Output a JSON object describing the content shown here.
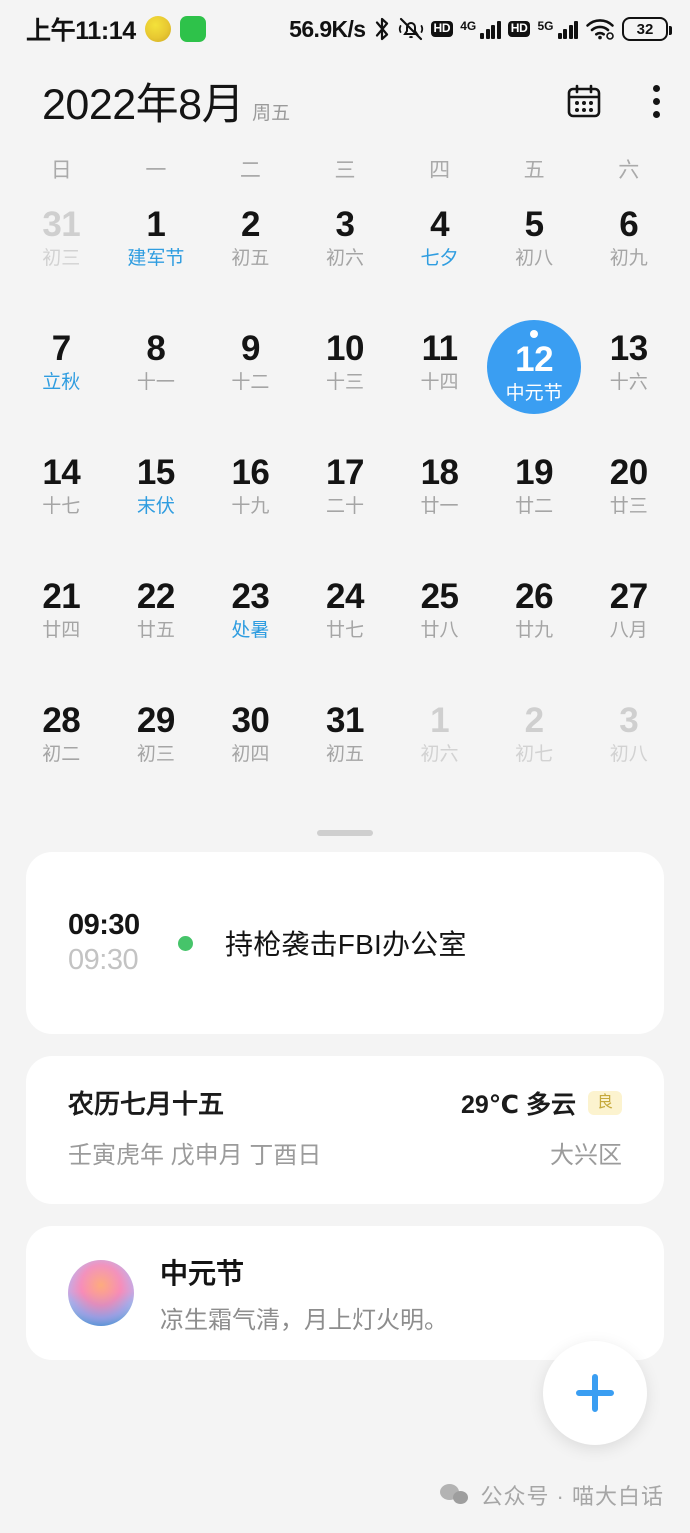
{
  "statusbar": {
    "time": "上午11:14",
    "network_speed": "56.9K/s",
    "hd_label_1": "HD",
    "gen_label_1": "4G",
    "hd_label_2": "HD",
    "gen_label_2": "5G",
    "battery": "32",
    "icons": [
      "notification-badge-yellow",
      "notification-badge-green",
      "bluetooth-icon",
      "mute-vibrate-icon",
      "signal-bars-icon",
      "wifi-icon",
      "battery-icon"
    ]
  },
  "header": {
    "title": "2022年8月",
    "weekday": "周五",
    "calendar_icon": "calendar-icon",
    "menu_icon": "more-vertical-icon"
  },
  "calendar": {
    "weekday_headers": [
      "日",
      "一",
      "二",
      "三",
      "四",
      "五",
      "六"
    ],
    "weeks": [
      [
        {
          "day": "31",
          "lunar": "初三",
          "dim": true,
          "selected": false,
          "highlight": false
        },
        {
          "day": "1",
          "lunar": "建军节",
          "dim": false,
          "selected": false,
          "highlight": true
        },
        {
          "day": "2",
          "lunar": "初五",
          "dim": false,
          "selected": false,
          "highlight": false
        },
        {
          "day": "3",
          "lunar": "初六",
          "dim": false,
          "selected": false,
          "highlight": false
        },
        {
          "day": "4",
          "lunar": "七夕",
          "dim": false,
          "selected": false,
          "highlight": true
        },
        {
          "day": "5",
          "lunar": "初八",
          "dim": false,
          "selected": false,
          "highlight": false
        },
        {
          "day": "6",
          "lunar": "初九",
          "dim": false,
          "selected": false,
          "highlight": false
        }
      ],
      [
        {
          "day": "7",
          "lunar": "立秋",
          "dim": false,
          "selected": false,
          "highlight": true
        },
        {
          "day": "8",
          "lunar": "十一",
          "dim": false,
          "selected": false,
          "highlight": false
        },
        {
          "day": "9",
          "lunar": "十二",
          "dim": false,
          "selected": false,
          "highlight": false
        },
        {
          "day": "10",
          "lunar": "十三",
          "dim": false,
          "selected": false,
          "highlight": false
        },
        {
          "day": "11",
          "lunar": "十四",
          "dim": false,
          "selected": false,
          "highlight": false
        },
        {
          "day": "12",
          "lunar": "中元节",
          "dim": false,
          "selected": true,
          "highlight": false
        },
        {
          "day": "13",
          "lunar": "十六",
          "dim": false,
          "selected": false,
          "highlight": false
        }
      ],
      [
        {
          "day": "14",
          "lunar": "十七",
          "dim": false,
          "selected": false,
          "highlight": false
        },
        {
          "day": "15",
          "lunar": "末伏",
          "dim": false,
          "selected": false,
          "highlight": true
        },
        {
          "day": "16",
          "lunar": "十九",
          "dim": false,
          "selected": false,
          "highlight": false
        },
        {
          "day": "17",
          "lunar": "二十",
          "dim": false,
          "selected": false,
          "highlight": false
        },
        {
          "day": "18",
          "lunar": "廿一",
          "dim": false,
          "selected": false,
          "highlight": false
        },
        {
          "day": "19",
          "lunar": "廿二",
          "dim": false,
          "selected": false,
          "highlight": false
        },
        {
          "day": "20",
          "lunar": "廿三",
          "dim": false,
          "selected": false,
          "highlight": false
        }
      ],
      [
        {
          "day": "21",
          "lunar": "廿四",
          "dim": false,
          "selected": false,
          "highlight": false
        },
        {
          "day": "22",
          "lunar": "廿五",
          "dim": false,
          "selected": false,
          "highlight": false
        },
        {
          "day": "23",
          "lunar": "处暑",
          "dim": false,
          "selected": false,
          "highlight": true
        },
        {
          "day": "24",
          "lunar": "廿七",
          "dim": false,
          "selected": false,
          "highlight": false
        },
        {
          "day": "25",
          "lunar": "廿八",
          "dim": false,
          "selected": false,
          "highlight": false
        },
        {
          "day": "26",
          "lunar": "廿九",
          "dim": false,
          "selected": false,
          "highlight": false
        },
        {
          "day": "27",
          "lunar": "八月",
          "dim": false,
          "selected": false,
          "highlight": false
        }
      ],
      [
        {
          "day": "28",
          "lunar": "初二",
          "dim": false,
          "selected": false,
          "highlight": false
        },
        {
          "day": "29",
          "lunar": "初三",
          "dim": false,
          "selected": false,
          "highlight": false
        },
        {
          "day": "30",
          "lunar": "初四",
          "dim": false,
          "selected": false,
          "highlight": false
        },
        {
          "day": "31",
          "lunar": "初五",
          "dim": false,
          "selected": false,
          "highlight": false
        },
        {
          "day": "1",
          "lunar": "初六",
          "dim": true,
          "selected": false,
          "highlight": false
        },
        {
          "day": "2",
          "lunar": "初七",
          "dim": true,
          "selected": false,
          "highlight": false
        },
        {
          "day": "3",
          "lunar": "初八",
          "dim": true,
          "selected": false,
          "highlight": false
        }
      ]
    ]
  },
  "event": {
    "start_time": "09:30",
    "end_time": "09:30",
    "title": "持枪袭击FBI办公室",
    "dot_color": "#46c46a"
  },
  "info": {
    "lunar_date": "农历七月十五",
    "ganzhi": "壬寅虎年 戊申月 丁酉日",
    "weather": "29℃ 多云",
    "aqi": "良",
    "location": "大兴区"
  },
  "festival": {
    "name": "中元节",
    "description": "凉生霜气清，月上灯火明。",
    "thumbnail": "lotus-lantern-image"
  },
  "fab": {
    "label": "+",
    "icon": "plus-icon",
    "color": "#3a9ef2"
  },
  "watermark": {
    "text": "公众号 · 喵大白话",
    "icon": "wechat-icon"
  },
  "colors": {
    "accent": "#3a9ef2",
    "highlight_text": "#2f9de0",
    "background": "#f4f4f4",
    "card": "#ffffff"
  }
}
